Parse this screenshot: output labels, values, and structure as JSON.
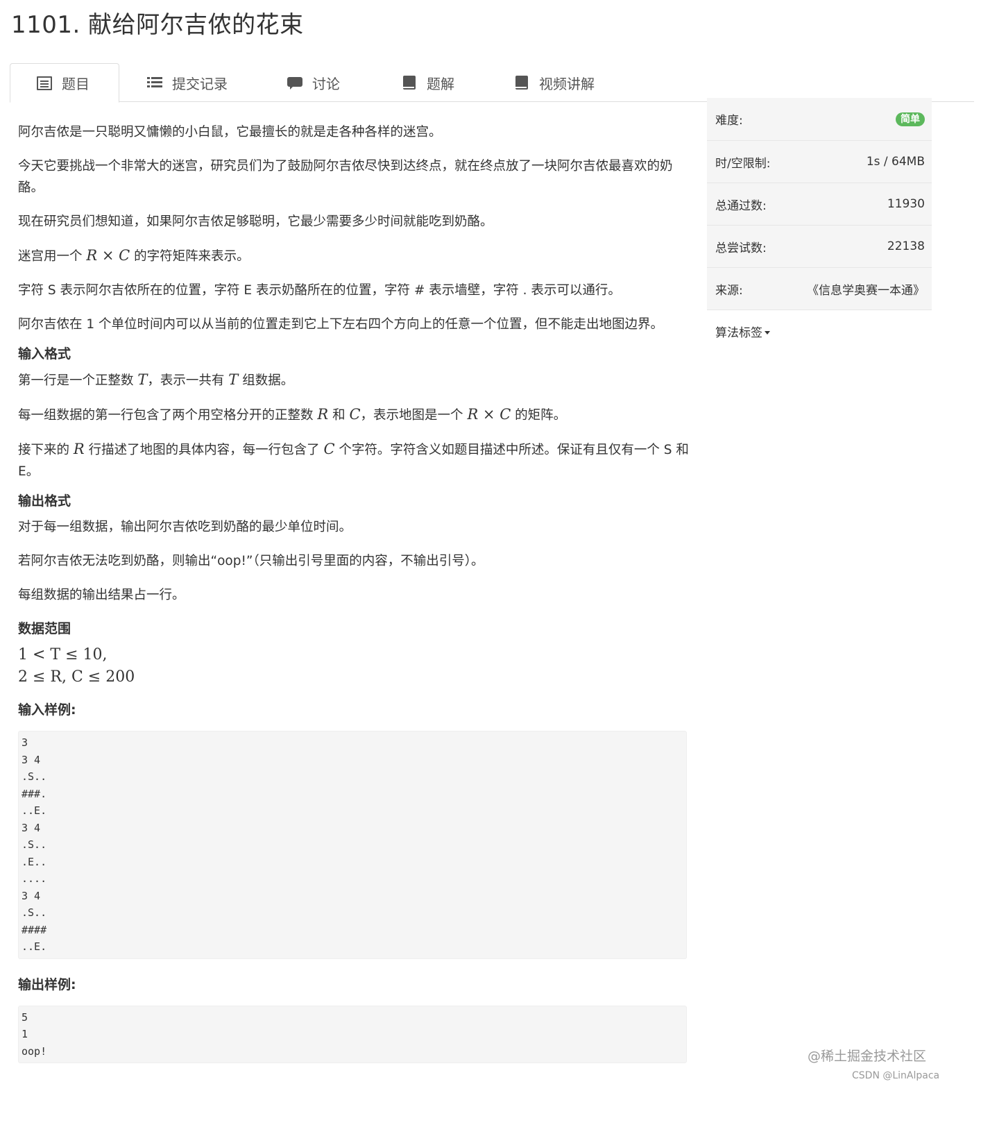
{
  "title": "1101. 献给阿尔吉侬的花束",
  "tabs": [
    {
      "label": "题目",
      "icon": "document-icon"
    },
    {
      "label": "提交记录",
      "icon": "list-icon"
    },
    {
      "label": "讨论",
      "icon": "chat-icon"
    },
    {
      "label": "题解",
      "icon": "book-icon"
    },
    {
      "label": "视频讲解",
      "icon": "book-icon"
    }
  ],
  "problem": {
    "p1": "阿尔吉侬是一只聪明又慵懒的小白鼠，它最擅长的就是走各种各样的迷宫。",
    "p2": "今天它要挑战一个非常大的迷宫，研究员们为了鼓励阿尔吉侬尽快到达终点，就在终点放了一块阿尔吉侬最喜欢的奶酪。",
    "p3": "现在研究员们想知道，如果阿尔吉侬足够聪明，它最少需要多少时间就能吃到奶酪。",
    "p4_a": "迷宫用一个 ",
    "p4_math": "R × C",
    "p4_b": " 的字符矩阵来表示。",
    "p5": "字符 S 表示阿尔吉侬所在的位置，字符 E 表示奶酪所在的位置，字符 # 表示墙壁，字符 . 表示可以通行。",
    "p6": "阿尔吉侬在 1 个单位时间内可以从当前的位置走到它上下左右四个方向上的任意一个位置，但不能走出地图边界。"
  },
  "input_format": {
    "heading": "输入格式",
    "l1_a": "第一行是一个正整数 ",
    "l1_m1": "T",
    "l1_b": "，表示一共有 ",
    "l1_m2": "T",
    "l1_c": " 组数据。",
    "l2_a": "每一组数据的第一行包含了两个用空格分开的正整数 ",
    "l2_m1": "R",
    "l2_b": " 和 ",
    "l2_m2": "C",
    "l2_c": "，表示地图是一个 ",
    "l2_m3": "R × C",
    "l2_d": " 的矩阵。",
    "l3_a": "接下来的 ",
    "l3_m1": "R",
    "l3_b": " 行描述了地图的具体内容，每一行包含了 ",
    "l3_m2": "C",
    "l3_c": " 个字符。字符含义如题目描述中所述。保证有且仅有一个 S 和 E。"
  },
  "output_format": {
    "heading": "输出格式",
    "l1": "对于每一组数据，输出阿尔吉侬吃到奶酪的最少单位时间。",
    "l2": "若阿尔吉侬无法吃到奶酪，则输出“oop!”（只输出引号里面的内容，不输出引号）。",
    "l3": "每组数据的输出结果占一行。"
  },
  "data_range": {
    "heading": "数据范围",
    "line1": "1 < T ≤ 10,",
    "line2": "2 ≤ R, C ≤ 200"
  },
  "sample_input": {
    "heading": "输入样例:",
    "text": "3\n3 4\n.S..\n###.\n..E.\n3 4\n.S..\n.E..\n....\n3 4\n.S..\n####\n..E."
  },
  "sample_output": {
    "heading": "输出样例:",
    "text": "5\n1\noop!"
  },
  "sidebar": {
    "difficulty_label": "难度:",
    "difficulty_value": "简单",
    "difficulty_color": "#5cb85c",
    "limit_label": "时/空限制:",
    "limit_value": "1s / 64MB",
    "passed_label": "总通过数:",
    "passed_value": "11930",
    "tried_label": "总尝试数:",
    "tried_value": "22138",
    "source_label": "来源:",
    "source_value": "《信息学奥赛一本通》",
    "tags_label": "算法标签"
  },
  "watermark": {
    "line1": "@稀土掘金技术社区",
    "line2": "CSDN @LinAlpaca"
  }
}
